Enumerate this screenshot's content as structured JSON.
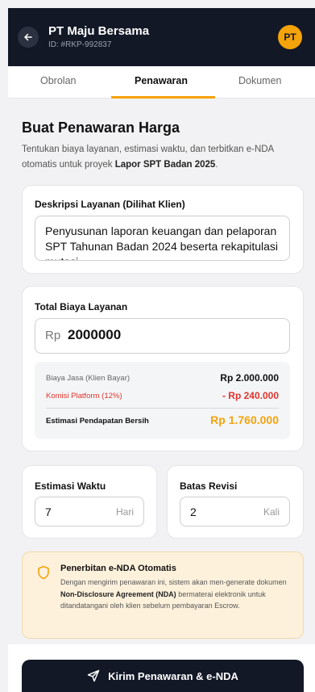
{
  "header": {
    "title": "PT Maju Bersama",
    "subtitle": "ID: #RKP-992837",
    "avatar_initials": "PT"
  },
  "tabs": [
    {
      "label": "Obrolan",
      "active": false
    },
    {
      "label": "Penawaran",
      "active": true
    },
    {
      "label": "Dokumen",
      "active": false
    }
  ],
  "main": {
    "title": "Buat Penawaran Harga",
    "description_prefix": "Tentukan biaya layanan, estimasi waktu, dan terbitkan e-NDA otomatis untuk proyek ",
    "project_name": "Lapor SPT Badan 2025",
    "description_suffix": "."
  },
  "service": {
    "label": "Deskripsi Layanan (Dilihat Klien)",
    "value": "Penyusunan laporan keuangan dan pelaporan SPT Tahunan Badan 2024 beserta rekapitulasi mutasi"
  },
  "cost": {
    "label": "Total Biaya Layanan",
    "currency_prefix": "Rp",
    "value": "2000000",
    "breakdown": {
      "fee_label": "Biaya Jasa (Klien Bayar)",
      "fee_value": "Rp 2.000.000",
      "commission_label": "Komisi Platform (12%)",
      "commission_value": "- Rp 240.000",
      "net_label": "Estimasi Pendapatan Bersih",
      "net_value": "Rp 1.760.000"
    }
  },
  "time": {
    "label": "Estimasi Waktu",
    "value": "7",
    "unit": "Hari"
  },
  "revision": {
    "label": "Batas Revisi",
    "value": "2",
    "unit": "Kali"
  },
  "nda": {
    "title": "Penerbitan e-NDA Otomatis",
    "text_1": "Dengan mengirim penawaran ini, sistem akan men-generate dokumen ",
    "text_bold": "Non-Disclosure Agreement (NDA)",
    "text_2": " bermaterai elektronik untuk ditandatangani oleh klien sebelum pembayaran Escrow."
  },
  "submit_label": "Kirim Penawaran & e-NDA",
  "colors": {
    "accent": "#f5a30a",
    "dark": "#121826",
    "danger": "#e0342c"
  },
  "icons": {
    "back": "arrow-left-icon",
    "nda": "shield-icon",
    "submit": "send-icon"
  }
}
